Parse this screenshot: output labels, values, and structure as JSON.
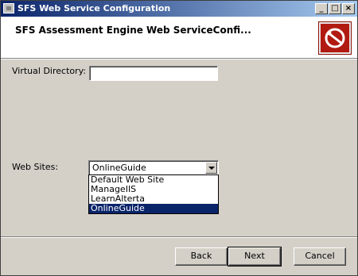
{
  "window": {
    "title": "SFS Web Service Configuration",
    "controls": {
      "minimize": "_",
      "maximize": "□",
      "close": "×"
    }
  },
  "header": {
    "title": "SFS Assessment Engine Web ServiceConfi...",
    "logo_icon": "tools-logo-icon",
    "logo_color": "#b11a10"
  },
  "form": {
    "virtual_directory": {
      "label": "Virtual Directory:",
      "value": ""
    },
    "web_sites": {
      "label": "Web Sites:",
      "selected": "OnlineGuide",
      "options": [
        "Default Web Site",
        "ManageIIS",
        "LearnAlterta",
        "OnlineGuide"
      ]
    }
  },
  "buttons": {
    "back": "Back",
    "next": "Next",
    "cancel": "Cancel"
  }
}
